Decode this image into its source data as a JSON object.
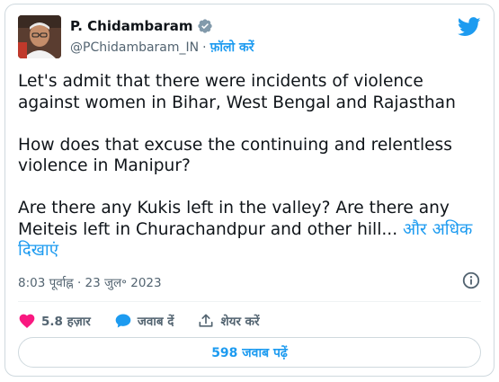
{
  "author": {
    "name": "P. Chidambaram",
    "handle": "@PChidambaram_IN",
    "separator": "·",
    "follow_label": "फ़ॉलो करें"
  },
  "tweet": {
    "paragraphs": [
      "Let's admit that there were incidents of violence against women in Bihar, West Bengal and Rajasthan",
      "How does that excuse the continuing and relentless violence in Manipur?",
      "Are there any Kukis left in the valley? Are there any Meiteis left in Churachandpur and other hill..."
    ],
    "show_more_label": "और अधिक दिखाएं"
  },
  "meta": {
    "timestamp": "8:03 पूर्वाह्न · 23 जुल॰ 2023"
  },
  "actions": {
    "likes": "5.8 हज़ार",
    "reply_label": "जवाब दें",
    "share_label": "शेयर करें"
  },
  "replies_button": "598 जवाब पढ़ें",
  "colors": {
    "accent": "#1d9bf0",
    "like": "#f91880",
    "muted": "#536471"
  }
}
